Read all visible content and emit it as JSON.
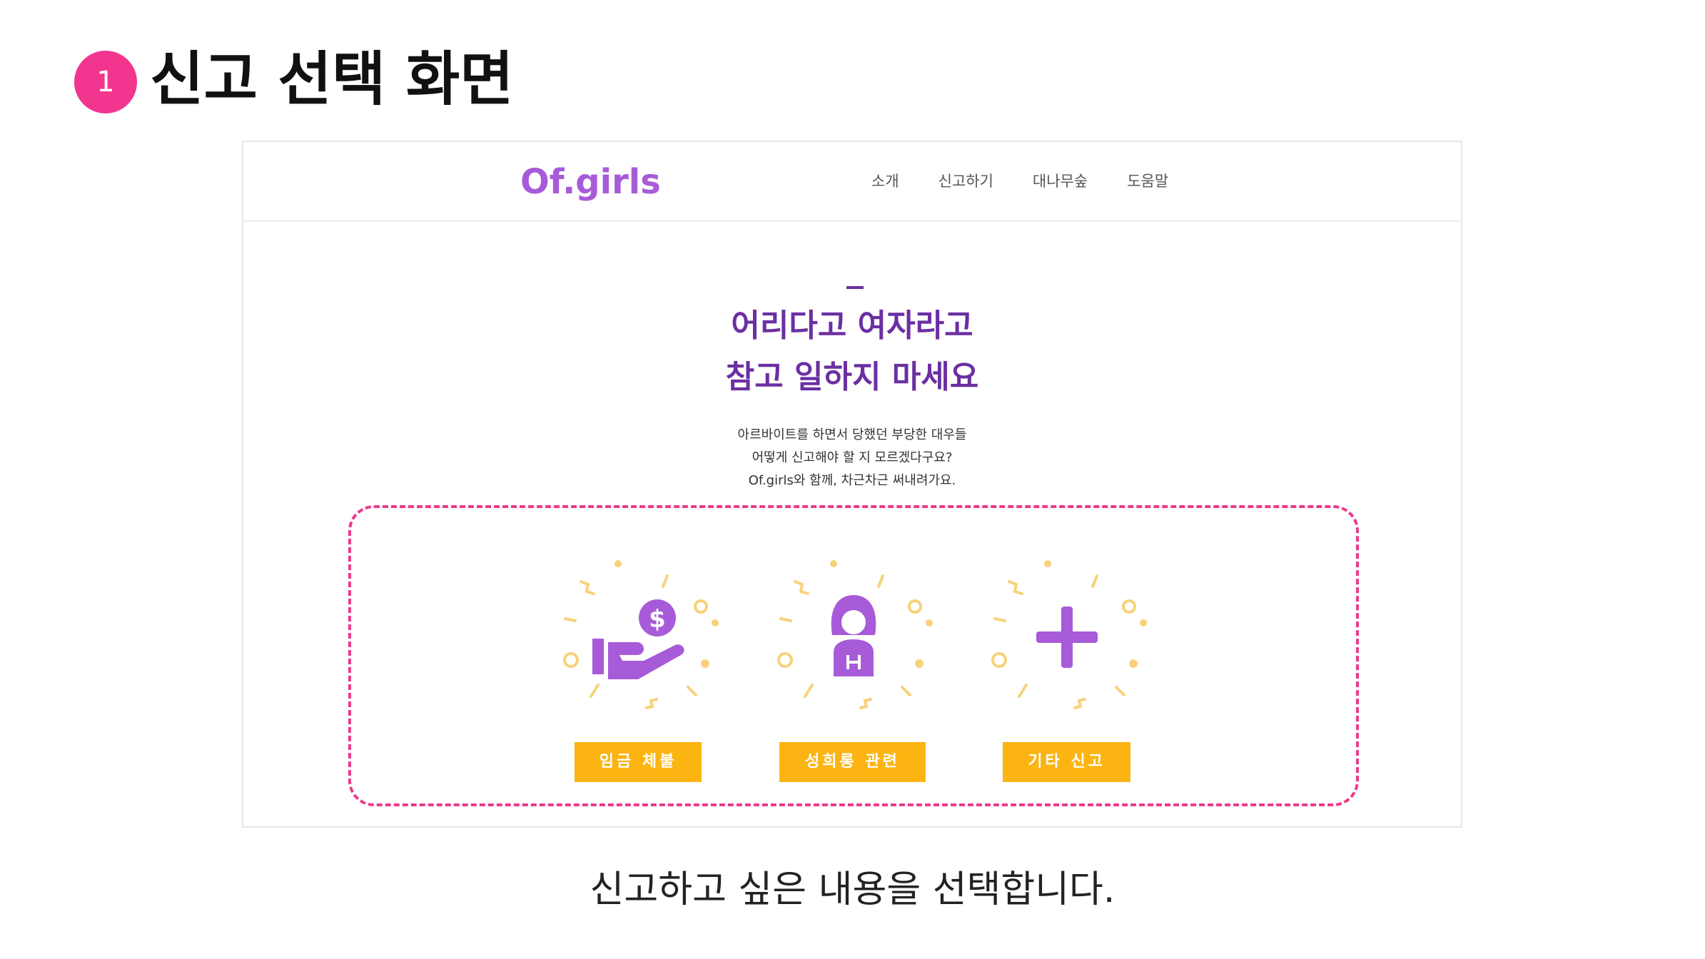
{
  "slide": {
    "step_number": "1",
    "title": "신고 선택 화면",
    "caption": "신고하고 싶은 내용을 선택합니다."
  },
  "site": {
    "logo": "Of.girls",
    "nav": [
      "소개",
      "신고하기",
      "대나무숲",
      "도움말"
    ]
  },
  "hero": {
    "title_line1": "어리다고 여자라고",
    "title_line2": "참고 일하지 마세요",
    "desc_line1": "아르바이트를 하면서 당했던 부당한 대우들",
    "desc_line2": "어떻게 신고해야 할 지 모르겠다구요?",
    "desc_line3": "Of.girls와 함께, 차근차근 써내려가요."
  },
  "options": [
    {
      "label": "임금 체불",
      "icon": "hand-money-icon"
    },
    {
      "label": "성희롱 관련",
      "icon": "woman-icon"
    },
    {
      "label": "기타 신고",
      "icon": "plus-icon"
    }
  ],
  "colors": {
    "accent_pink": "#f2358f",
    "logo_purple": "#a75bd8",
    "hero_purple": "#6b2fa2",
    "icon_purple": "#a75bd8",
    "button_yellow": "#fbb412",
    "sparkle_yellow": "#f8d27a",
    "dashed_border": "#ec3a8c"
  }
}
